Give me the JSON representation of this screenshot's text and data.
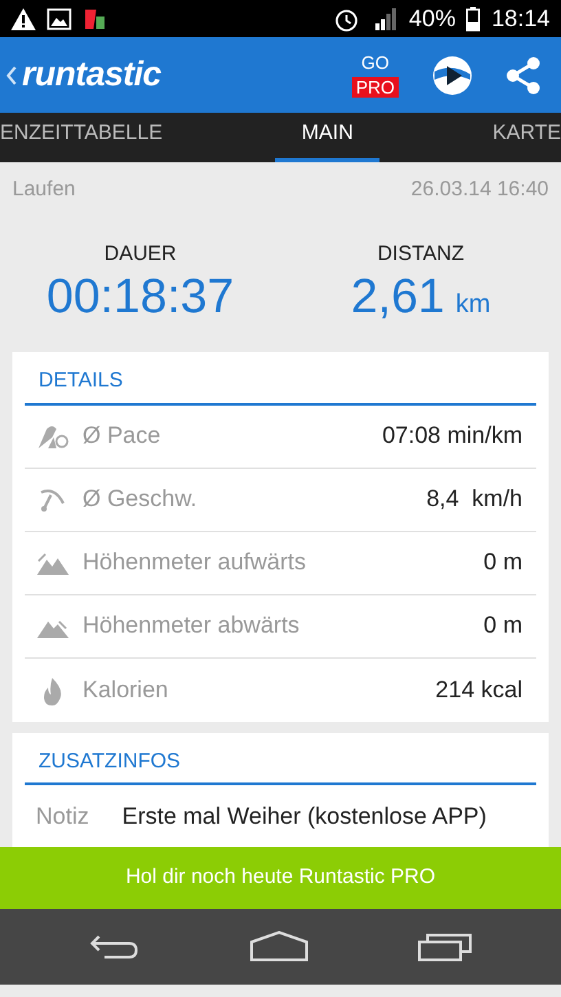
{
  "status_bar": {
    "battery": "40%",
    "time": "18:14"
  },
  "app_bar": {
    "logo": "runtastic",
    "go": "GO",
    "pro": "PRO"
  },
  "tabs": [
    {
      "label": "ENZEITTABELLE",
      "selected": false
    },
    {
      "label": "MAIN",
      "selected": true
    },
    {
      "label": "KARTE",
      "selected": false
    }
  ],
  "activity": {
    "type": "Laufen",
    "date": "26.03.14 16:40"
  },
  "stats": [
    {
      "label": "DAUER",
      "value": "00:18:37"
    },
    {
      "label": "DISTANZ",
      "value": "2,61",
      "unit": "km"
    }
  ],
  "details": {
    "title": "DETAILS",
    "rows": [
      {
        "kind": "pace",
        "label": "Ø Pace",
        "value": "07:08 min/km"
      },
      {
        "kind": "speed",
        "label": "Ø Geschw.",
        "value": "8,4  km/h"
      },
      {
        "kind": "ascent",
        "label": "Höhenmeter aufwärts",
        "value": "0 m"
      },
      {
        "kind": "descent",
        "label": "Höhenmeter abwärts",
        "value": "0 m"
      },
      {
        "kind": "calories",
        "label": "Kalorien",
        "value": "214 kcal"
      }
    ]
  },
  "extra": {
    "title": "ZUSATZINFOS",
    "rows": [
      {
        "label": "Notiz",
        "value": "Erste mal Weiher (kostenlose APP)"
      }
    ]
  },
  "banner": "Hol dir noch heute Runtastic PRO"
}
